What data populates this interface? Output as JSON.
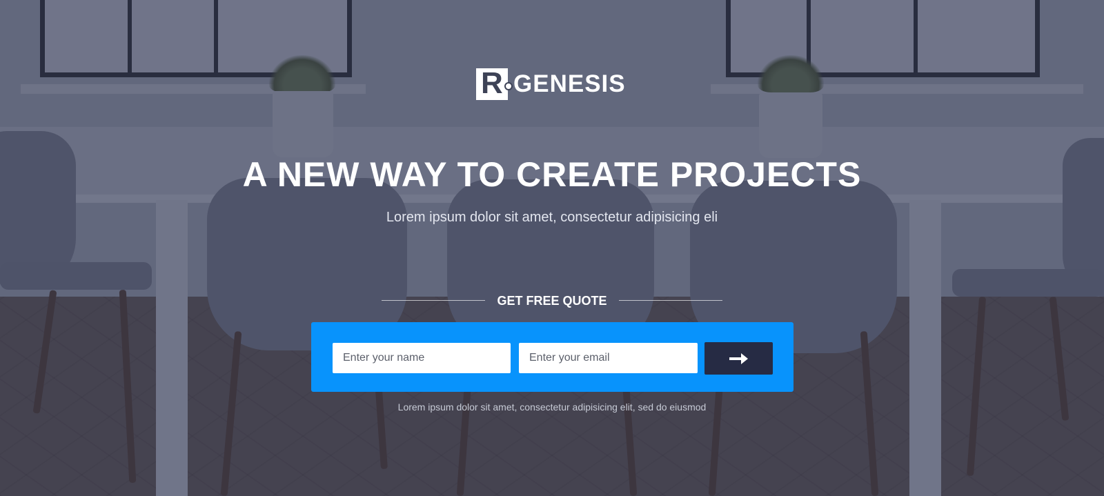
{
  "brand": {
    "logo_mark_letter": "R",
    "logo_name": "GENESIS",
    "icon": "logo-icon"
  },
  "hero": {
    "headline": "A NEW WAY TO CREATE PROJECTS",
    "subtitle": "Lorem ipsum dolor sit amet, consectetur adipisicing eli"
  },
  "quote_form": {
    "title": "GET FREE QUOTE",
    "name_placeholder": "Enter your name",
    "email_placeholder": "Enter your email",
    "submit_icon": "arrow-right-icon",
    "footnote": "Lorem ipsum dolor sit amet, consectetur adipisicing elit, sed do eiusmod"
  },
  "colors": {
    "form_background": "#0893fc",
    "submit_button": "#262b44",
    "text_primary": "#ffffff"
  }
}
